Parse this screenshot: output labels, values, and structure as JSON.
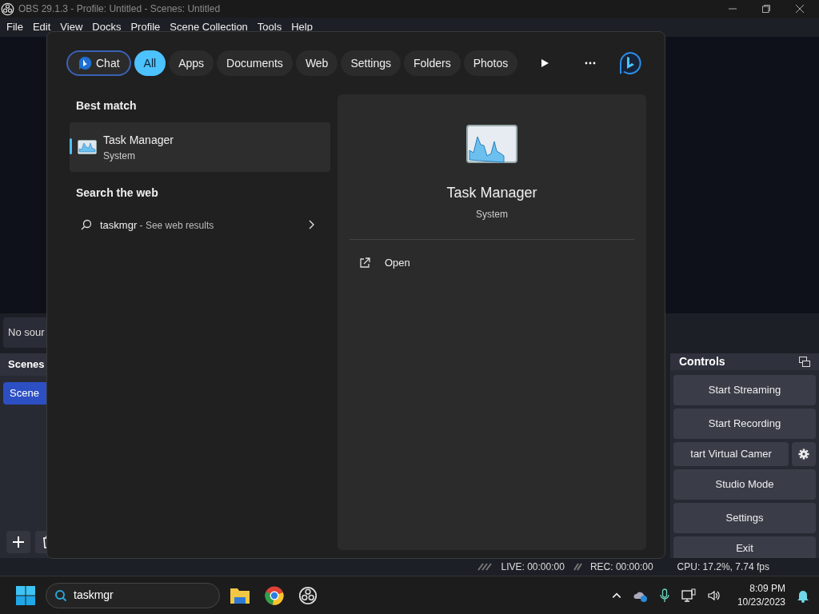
{
  "window": {
    "title": "OBS 29.1.3 - Profile: Untitled - Scenes: Untitled"
  },
  "menu": [
    "File",
    "Edit",
    "View",
    "Docks",
    "Profile",
    "Scene Collection",
    "Tools",
    "Help"
  ],
  "sources": {
    "empty_text": "No sour"
  },
  "scenes": {
    "title": "Scenes",
    "items": [
      {
        "label": "Scene",
        "selected": true
      }
    ]
  },
  "controls": {
    "title": "Controls",
    "buttons": [
      {
        "label": "Start Streaming",
        "kind": "wide"
      },
      {
        "label": "Start Recording",
        "kind": "wide"
      },
      {
        "label": "tart Virtual Camer",
        "kind": "with-settings"
      },
      {
        "label": "Studio Mode",
        "kind": "wide"
      },
      {
        "label": "Settings",
        "kind": "wide"
      },
      {
        "label": "Exit",
        "kind": "wide"
      }
    ]
  },
  "status_bar": {
    "live": "LIVE: 00:00:00",
    "rec": "REC: 00:00:00",
    "cpu": "CPU: 17.2%, 7.74 fps"
  },
  "search_popup": {
    "filters": [
      {
        "label": "Chat",
        "kind": "chat",
        "selected": false
      },
      {
        "label": "All",
        "kind": "filter",
        "selected": true
      },
      {
        "label": "Apps",
        "kind": "filter",
        "selected": false
      },
      {
        "label": "Documents",
        "kind": "filter",
        "selected": false
      },
      {
        "label": "Web",
        "kind": "filter",
        "selected": false
      },
      {
        "label": "Settings",
        "kind": "filter",
        "selected": false
      },
      {
        "label": "Folders",
        "kind": "filter",
        "selected": false
      },
      {
        "label": "Photos",
        "kind": "filter",
        "selected": false
      }
    ],
    "best_match_heading": "Best match",
    "best_match": {
      "name": "Task Manager",
      "subtitle": "System",
      "selected": true
    },
    "web_heading": "Search the web",
    "web_result": {
      "query": "taskmgr",
      "hint": " - See web results"
    },
    "preview": {
      "name": "Task Manager",
      "subtitle": "System",
      "actions": [
        "Open"
      ]
    }
  },
  "taskbar": {
    "search_value": "taskmgr",
    "time": "8:09 PM",
    "date": "10/23/2023"
  }
}
